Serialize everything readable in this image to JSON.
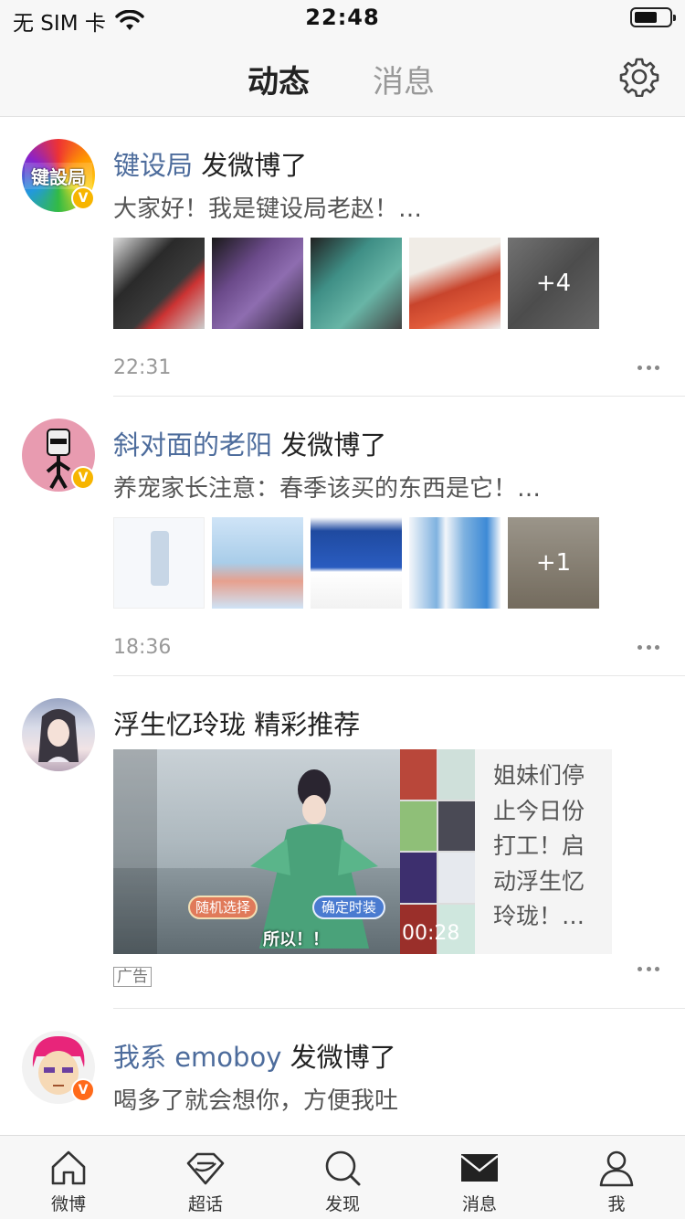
{
  "status_bar": {
    "carrier": "无 SIM 卡",
    "time": "22:48"
  },
  "header": {
    "tabs": [
      {
        "label": "动态",
        "active": true
      },
      {
        "label": "消息",
        "active": false
      }
    ],
    "settings_icon": "gear-icon",
    "accent_color": "#ff9a17"
  },
  "feed": {
    "items": [
      {
        "username": "键设局",
        "action": "发微博了",
        "snippet": "大家好！我是键设局老赵！…",
        "more_count": "+4",
        "time": "22:31",
        "avatar_text": "键設局",
        "verified": true
      },
      {
        "username": "斜对面的老阳",
        "action": "发微博了",
        "snippet": "养宠家长注意：春季该买的东西是它！…",
        "more_count": "+1",
        "time": "18:36",
        "verified": true
      },
      {
        "title": "浮生忆玲珑 精彩推荐",
        "ad_text": "姐妹们停止今日份打工！启动浮生忆玲珑！…",
        "video_duration": "00:28",
        "video_buttons": [
          "随机选择",
          "确定时装"
        ],
        "video_caption": "所以！！",
        "ad_label": "广告"
      },
      {
        "username": "我系 emoboy",
        "action": "发微博了",
        "snippet": "喝多了就会想你，方便我吐",
        "verified": true
      }
    ]
  },
  "tabbar": {
    "items": [
      {
        "label": "微博",
        "icon": "home-icon"
      },
      {
        "label": "超话",
        "icon": "diamond-icon"
      },
      {
        "label": "发现",
        "icon": "search-icon"
      },
      {
        "label": "消息",
        "icon": "mail-icon"
      },
      {
        "label": "我",
        "icon": "profile-icon"
      }
    ]
  }
}
